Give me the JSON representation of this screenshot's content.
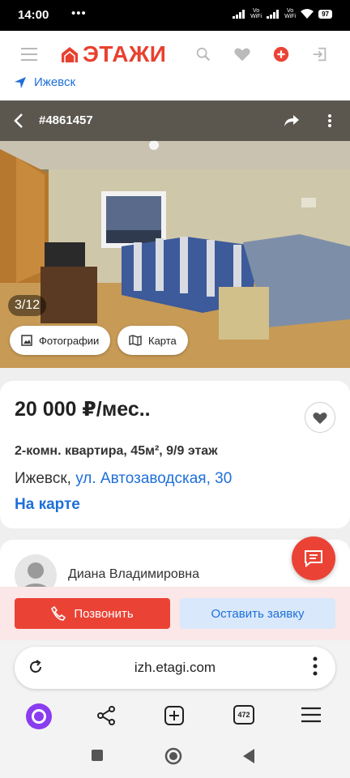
{
  "status_bar": {
    "time": "14:00",
    "dots": "•••",
    "vowifi1": "Vo\nWiFi",
    "vowifi2": "Vo\nWiFi",
    "battery": "97"
  },
  "header": {
    "logo_text": "ЭТАЖИ",
    "city": "Ижевск",
    "accent_color": "#e8412f",
    "link_color": "#1e6fd9"
  },
  "photo": {
    "listing_id": "#4861457",
    "counter": "3/12",
    "photos_label": "Фотографии",
    "map_label": "Карта"
  },
  "listing": {
    "price": "20 000 ₽/мес..",
    "specs": "2-комн. квартира, 45м², 9/9 этаж",
    "city": "Ижевск,",
    "street": "ул. Автозаводская, 30",
    "on_map": "На карте"
  },
  "agent": {
    "name": "Диана Владимировна"
  },
  "actions": {
    "call_label": "Позвонить",
    "request_label": "Оставить заявку"
  },
  "browser": {
    "url": "izh.etagi.com",
    "tab_count": "472"
  }
}
